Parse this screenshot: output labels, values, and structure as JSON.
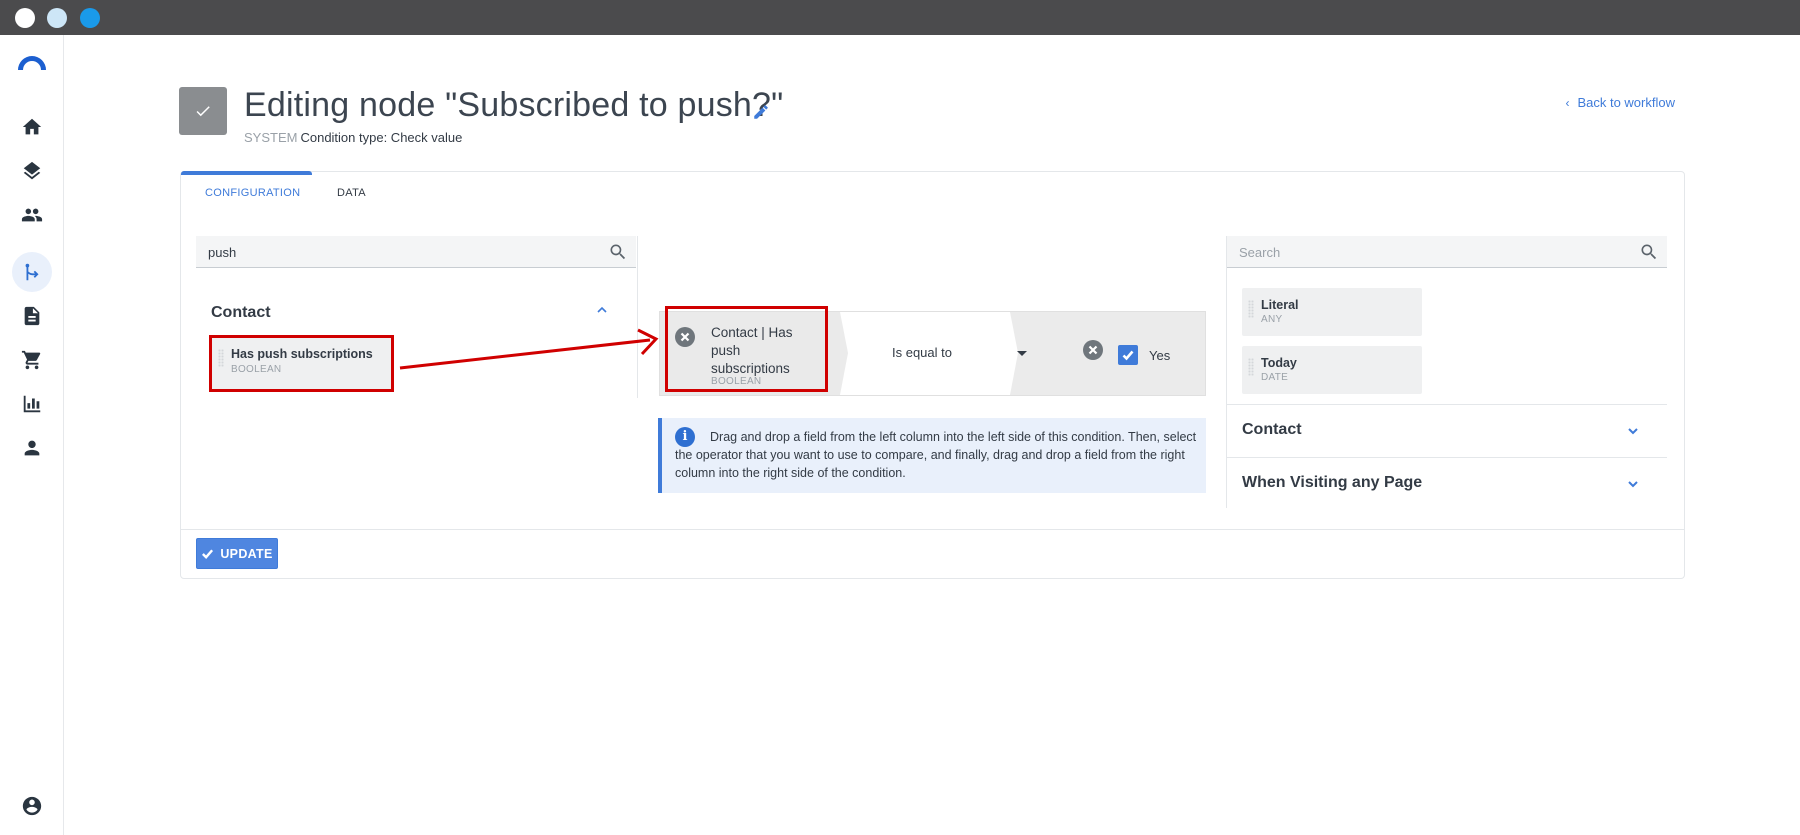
{
  "header": {
    "title": "Editing node \"Subscribed to push?\"",
    "system_label": "SYSTEM",
    "condition_type": "Condition type: Check value",
    "back_link": "Back to workflow"
  },
  "tabs": [
    {
      "label": "CONFIGURATION",
      "active": true
    },
    {
      "label": "DATA",
      "active": false
    }
  ],
  "left_panel": {
    "search_value": "push",
    "group": "Contact",
    "fields": [
      {
        "name": "Has push subscriptions",
        "type": "BOOLEAN"
      }
    ]
  },
  "condition": {
    "left_field": "Contact | Has push subscriptions",
    "left_type": "BOOLEAN",
    "operator": "Is equal to",
    "right_value": "Yes",
    "right_checked": true
  },
  "info": {
    "text": "Drag and drop a field from the left column into the left side of this condition. Then, select the operator that you want to use to compare, and finally, drag and drop a field from the right column into the right side of the condition."
  },
  "right_panel": {
    "search_placeholder": "Search",
    "items": [
      {
        "name": "Literal",
        "type": "ANY"
      },
      {
        "name": "Today",
        "type": "DATE"
      }
    ],
    "groups": [
      {
        "label": "Contact"
      },
      {
        "label": "When Visiting any Page"
      }
    ]
  },
  "footer": {
    "update_label": "UPDATE"
  },
  "colors": {
    "accent": "#3f7bd9",
    "highlight": "#d00000",
    "titlebar": "#4b4b4d"
  },
  "icons": {
    "sidebar": [
      "home-icon",
      "layers-icon",
      "people-icon",
      "workflow-icon",
      "document-icon",
      "cart-icon",
      "chart-icon",
      "person-icon"
    ],
    "bottom": "account-circle-icon"
  }
}
